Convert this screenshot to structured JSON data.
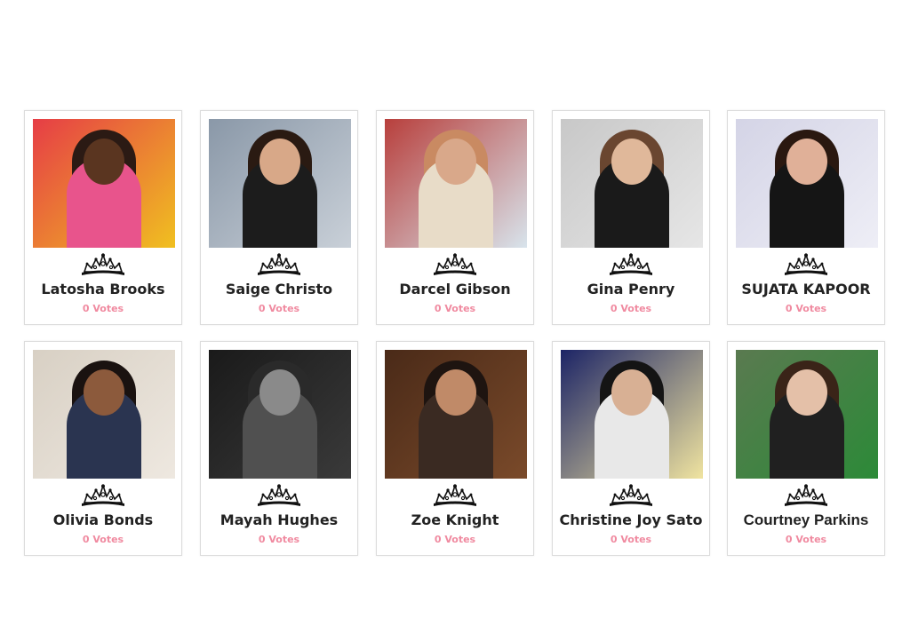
{
  "contestants": [
    {
      "name": "Latosha Brooks",
      "votes": "0 Votes",
      "palette": {
        "bg": "#e63d46",
        "bg2": "#f0c020",
        "hair": "#2b1a14",
        "skin": "#5a3520",
        "outfit": "#e8548c"
      }
    },
    {
      "name": "Saige Christo",
      "votes": "0 Votes",
      "palette": {
        "bg": "#8a98a8",
        "bg2": "#c9d0d8",
        "hair": "#2a1a12",
        "skin": "#d8a888",
        "outfit": "#1c1c1c"
      }
    },
    {
      "name": "Darcel Gibson",
      "votes": "0 Votes",
      "palette": {
        "bg": "#b83f3c",
        "bg2": "#d8e4ec",
        "hair": "#c98a62",
        "skin": "#d9a88a",
        "outfit": "#e8dcc8"
      }
    },
    {
      "name": "Gina Penry",
      "votes": "0 Votes",
      "palette": {
        "bg": "#c8c8c8",
        "bg2": "#e6e6e6",
        "hair": "#6a4630",
        "skin": "#e0b89a",
        "outfit": "#1a1a1a"
      }
    },
    {
      "name": "SUJATA KAPOOR",
      "votes": "0 Votes",
      "palette": {
        "bg": "#d4d4e6",
        "bg2": "#eeeef6",
        "hair": "#2a1810",
        "skin": "#e0b098",
        "outfit": "#151515"
      }
    },
    {
      "name": "Olivia Bonds",
      "votes": "0 Votes",
      "palette": {
        "bg": "#d8d0c4",
        "bg2": "#eee8e0",
        "hair": "#1a1210",
        "skin": "#8c5a3c",
        "outfit": "#2a3450"
      }
    },
    {
      "name": "Mayah Hughes",
      "votes": "0 Votes",
      "palette": {
        "bg": "#1a1a1a",
        "bg2": "#3a3a3a",
        "hair": "#2a2a2a",
        "skin": "#8a8a8a",
        "outfit": "#505050"
      }
    },
    {
      "name": "Zoe Knight",
      "votes": "0 Votes",
      "palette": {
        "bg": "#4a2a18",
        "bg2": "#7a4a2a",
        "hair": "#1e1410",
        "skin": "#c08a68",
        "outfit": "#3a2a22"
      }
    },
    {
      "name": "Christine Joy Sato",
      "votes": "0 Votes",
      "palette": {
        "bg": "#1c2466",
        "bg2": "#f0e4a0",
        "hair": "#141414",
        "skin": "#d8b094",
        "outfit": "#e8e8e8"
      }
    },
    {
      "name": "Courtney Parkins",
      "votes": "0 Votes",
      "palette": {
        "bg": "#5a7a50",
        "bg2": "#2c8a38",
        "hair": "#3a2418",
        "skin": "#e4c0a8",
        "outfit": "#202020"
      }
    }
  ],
  "colors": {
    "name": "#222222",
    "votes": "#f08aa0",
    "card_border": "#dcdcdc"
  },
  "icons": {
    "crown": "tiara-crown-icon"
  }
}
